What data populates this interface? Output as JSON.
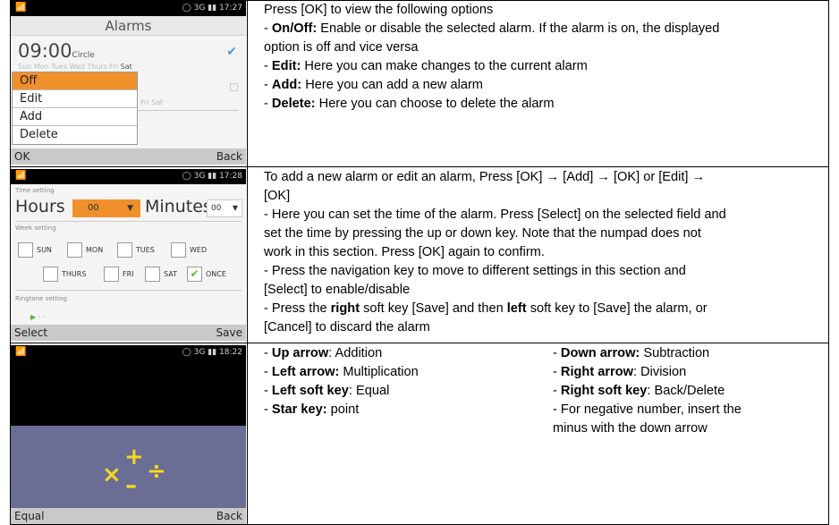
{
  "row1": {
    "screen": {
      "status_time": "17:27",
      "status_net": "3G",
      "title": "Alarms",
      "alarm1_time": "09:00",
      "alarm1_label": "Circle",
      "alarm1_days": "Sun Mon Tues Wed Thurs Fri",
      "alarm1_active_day": "Sat",
      "alarm2_days": "Fri Sat",
      "menu": [
        "Off",
        "Edit",
        "Add",
        "Delete"
      ],
      "soft_left": "OK",
      "soft_right": "Back"
    },
    "lines": [
      {
        "plain": "Press [OK] to view the following options"
      },
      {
        "prefix": "- ",
        "bold": "On/Off:",
        "rest": " Enable or disable the selected alarm. If the alarm is on, the displayed"
      },
      {
        "plain": "option is off and vice versa"
      },
      {
        "prefix": "- ",
        "bold": "Edit:",
        "rest": " Here you can make changes to the current alarm"
      },
      {
        "prefix": "- ",
        "bold": "Add:",
        "rest": " Here you can add a new alarm"
      },
      {
        "prefix": "- ",
        "bold": "Delete:",
        "rest": " Here you can choose to delete the alarm"
      }
    ]
  },
  "row2": {
    "screen": {
      "status_time": "17:28",
      "status_net": "3G",
      "time_setting_label": "Time setting",
      "hours_label": "Hours",
      "hours_value": "00",
      "minutes_label": "Minutes",
      "minutes_value": "00",
      "week_setting_label": "Week setting",
      "days": [
        "SUN",
        "MON",
        "TUES",
        "WED",
        "THURS",
        "FRI",
        "SAT",
        "ONCE"
      ],
      "ringtone_label": "Ringtone setting",
      "soft_left": "Select",
      "soft_right": "Save"
    },
    "lines": [
      {
        "plain": "To add a new alarm or edit an alarm,  Press [OK] → [Add] → [OK] or [Edit] →"
      },
      {
        "plain": "[OK]"
      },
      {
        "plain": "- Here you can set the time of the alarm. Press [Select] on the selected field and"
      },
      {
        "plain": "set the time by pressing the up or down key. Note that the numpad does not"
      },
      {
        "plain": "work in this section. Press [OK] again to confirm."
      },
      {
        "plain": "- Press the navigation key to move to different settings in this section and"
      },
      {
        "plain": "[Select] to enable/disable"
      },
      {
        "prefix": "- Press the ",
        "bold": "right",
        "rest": " soft key [Save] and then ",
        "bold2": "left",
        "rest2": " soft key to [Save] the alarm, or"
      },
      {
        "plain": "[Cancel] to discard the alarm"
      }
    ]
  },
  "row3": {
    "screen": {
      "status_time": "18:22",
      "status_net": "3G",
      "ops": [
        "×",
        "+",
        "–",
        "÷"
      ],
      "soft_left": "Equal",
      "soft_right": "Back"
    },
    "left": [
      {
        "prefix": "- ",
        "bold": "Up arrow",
        "rest": ": Addition"
      },
      {
        "prefix": "- ",
        "bold": "Left arrow:",
        "rest": " Multiplication"
      },
      {
        "prefix": "- ",
        "bold": "Left soft key",
        "rest": ": Equal"
      },
      {
        "prefix": "- ",
        "bold": "Star key:",
        "rest": " point"
      }
    ],
    "right": [
      {
        "prefix": "- ",
        "bold": "Down arrow:",
        "rest": " Subtraction"
      },
      {
        "prefix": "- ",
        "bold": "Right arrow",
        "rest": ": Division"
      },
      {
        "prefix": "- ",
        "bold": "Right soft key",
        "rest": ": Back/Delete"
      },
      {
        "prefix": "- For negative number, insert the",
        "bold": "",
        "rest": ""
      },
      {
        "prefix": "minus with the down arrow",
        "bold": "",
        "rest": ""
      }
    ]
  }
}
